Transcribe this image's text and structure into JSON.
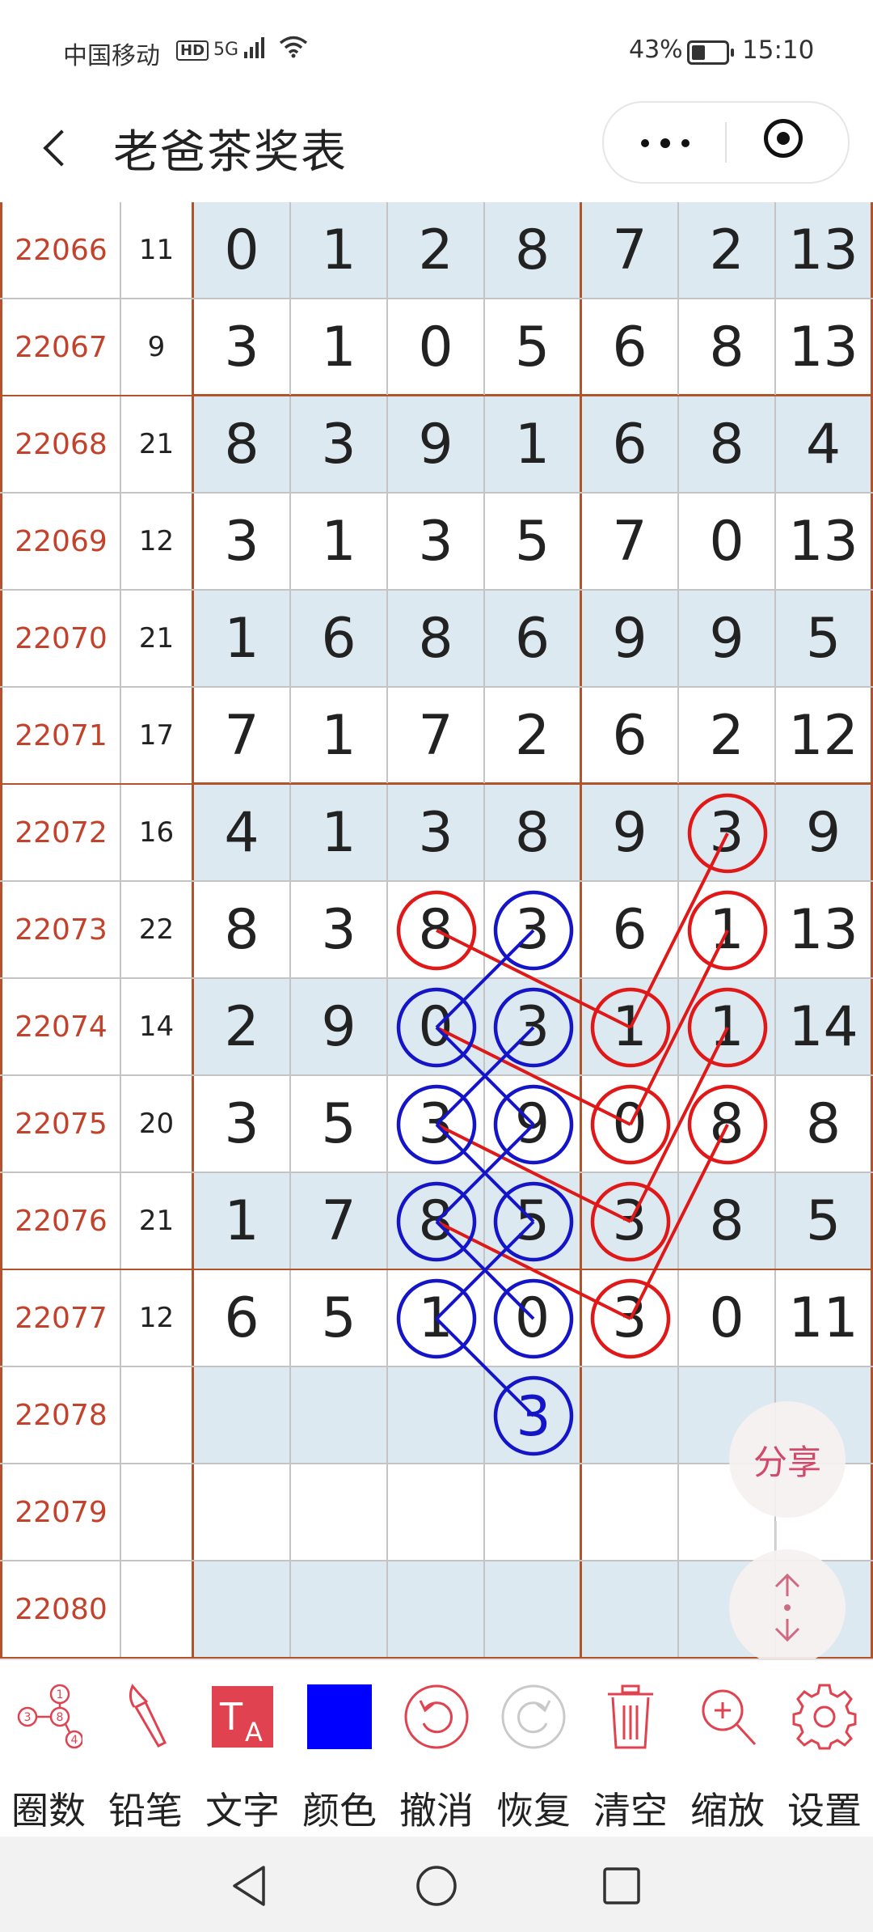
{
  "status_bar": {
    "carrier": "中国移动",
    "net_badge": "HD",
    "net_type": "5G",
    "battery_percent": "43%",
    "battery_level": 0.43,
    "time": "15:10"
  },
  "header": {
    "title": "老爸茶奖表",
    "more_icon": "more-dots-icon",
    "close_icon": "target-close-icon"
  },
  "table": {
    "rows": [
      {
        "id": "22066",
        "sum": "11",
        "values": [
          "0",
          "1",
          "2",
          "8",
          "7",
          "2",
          "13"
        ]
      },
      {
        "id": "22067",
        "sum": "9",
        "values": [
          "3",
          "1",
          "0",
          "5",
          "6",
          "8",
          "13"
        ]
      },
      {
        "id": "22068",
        "sum": "21",
        "values": [
          "8",
          "3",
          "9",
          "1",
          "6",
          "8",
          "4"
        ]
      },
      {
        "id": "22069",
        "sum": "12",
        "values": [
          "3",
          "1",
          "3",
          "5",
          "7",
          "0",
          "13"
        ]
      },
      {
        "id": "22070",
        "sum": "21",
        "values": [
          "1",
          "6",
          "8",
          "6",
          "9",
          "9",
          "5"
        ]
      },
      {
        "id": "22071",
        "sum": "17",
        "values": [
          "7",
          "1",
          "7",
          "2",
          "6",
          "2",
          "12"
        ]
      },
      {
        "id": "22072",
        "sum": "16",
        "values": [
          "4",
          "1",
          "3",
          "8",
          "9",
          "3",
          "9"
        ]
      },
      {
        "id": "22073",
        "sum": "22",
        "values": [
          "8",
          "3",
          "8",
          "3",
          "6",
          "1",
          "13"
        ]
      },
      {
        "id": "22074",
        "sum": "14",
        "values": [
          "2",
          "9",
          "0",
          "3",
          "1",
          "1",
          "14"
        ]
      },
      {
        "id": "22075",
        "sum": "20",
        "values": [
          "3",
          "5",
          "3",
          "9",
          "0",
          "8",
          "8"
        ]
      },
      {
        "id": "22076",
        "sum": "21",
        "values": [
          "1",
          "7",
          "8",
          "5",
          "3",
          "8",
          "5"
        ]
      },
      {
        "id": "22077",
        "sum": "12",
        "values": [
          "6",
          "5",
          "1",
          "0",
          "3",
          "0",
          "11"
        ]
      },
      {
        "id": "22078",
        "sum": "",
        "values": [
          "",
          "",
          "",
          "",
          "",
          "",
          ""
        ]
      },
      {
        "id": "22079",
        "sum": "",
        "values": [
          "",
          "",
          "",
          "",
          "",
          "",
          ""
        ]
      },
      {
        "id": "22080",
        "sum": "",
        "values": [
          "",
          "",
          "",
          "",
          "",
          "",
          ""
        ]
      }
    ],
    "annotations": {
      "red_circles": [
        [
          6,
          5
        ],
        [
          7,
          2
        ],
        [
          7,
          5
        ],
        [
          8,
          4
        ],
        [
          8,
          5
        ],
        [
          9,
          4
        ],
        [
          9,
          5
        ],
        [
          10,
          4
        ],
        [
          11,
          4
        ]
      ],
      "blue_circles": [
        [
          7,
          3
        ],
        [
          8,
          2
        ],
        [
          8,
          3
        ],
        [
          9,
          2
        ],
        [
          9,
          3
        ],
        [
          10,
          2
        ],
        [
          10,
          3
        ],
        [
          11,
          2
        ],
        [
          11,
          3
        ],
        [
          12,
          3
        ]
      ],
      "blue_added_text": {
        "row": 12,
        "col": 3,
        "text": "3"
      },
      "red_lines": [
        [
          [
            6,
            5
          ],
          [
            8,
            4
          ]
        ],
        [
          [
            7,
            5
          ],
          [
            9,
            4
          ]
        ],
        [
          [
            8,
            5
          ],
          [
            10,
            4
          ]
        ],
        [
          [
            9,
            5
          ],
          [
            11,
            4
          ]
        ],
        [
          [
            7,
            2
          ],
          [
            8,
            4
          ]
        ],
        [
          [
            8,
            2
          ],
          [
            9,
            4
          ]
        ],
        [
          [
            9,
            2
          ],
          [
            10,
            4
          ]
        ],
        [
          [
            10,
            2
          ],
          [
            11,
            4
          ]
        ]
      ],
      "blue_lines": [
        [
          [
            7,
            3
          ],
          [
            8,
            2
          ]
        ],
        [
          [
            8,
            3
          ],
          [
            9,
            2
          ]
        ],
        [
          [
            9,
            3
          ],
          [
            10,
            2
          ]
        ],
        [
          [
            10,
            3
          ],
          [
            11,
            2
          ]
        ],
        [
          [
            8,
            2
          ],
          [
            9,
            3
          ]
        ],
        [
          [
            9,
            2
          ],
          [
            10,
            3
          ]
        ],
        [
          [
            10,
            2
          ],
          [
            11,
            3
          ]
        ],
        [
          [
            11,
            2
          ],
          [
            12,
            3
          ]
        ]
      ],
      "red_color": "#e01818",
      "blue_color": "#1414c8"
    }
  },
  "floating": {
    "share_label": "分享",
    "scroll_icon": "updown-arrows-icon"
  },
  "toolbar": {
    "items": [
      {
        "label": "圈数",
        "icon": "circle-numbers-icon"
      },
      {
        "label": "铅笔",
        "icon": "brush-icon"
      },
      {
        "label": "文字",
        "icon": "text-icon"
      },
      {
        "label": "颜色",
        "icon": "color-swatch-icon"
      },
      {
        "label": "撤消",
        "icon": "undo-icon"
      },
      {
        "label": "恢复",
        "icon": "redo-icon"
      },
      {
        "label": "清空",
        "icon": "trash-icon"
      },
      {
        "label": "缩放",
        "icon": "zoom-in-icon"
      },
      {
        "label": "设置",
        "icon": "gear-icon"
      }
    ],
    "selected_color": "#0000ff",
    "accent_color": "#e0424f"
  },
  "navbar": {
    "buttons": [
      "back-triangle-icon",
      "home-circle-icon",
      "recents-square-icon"
    ]
  }
}
